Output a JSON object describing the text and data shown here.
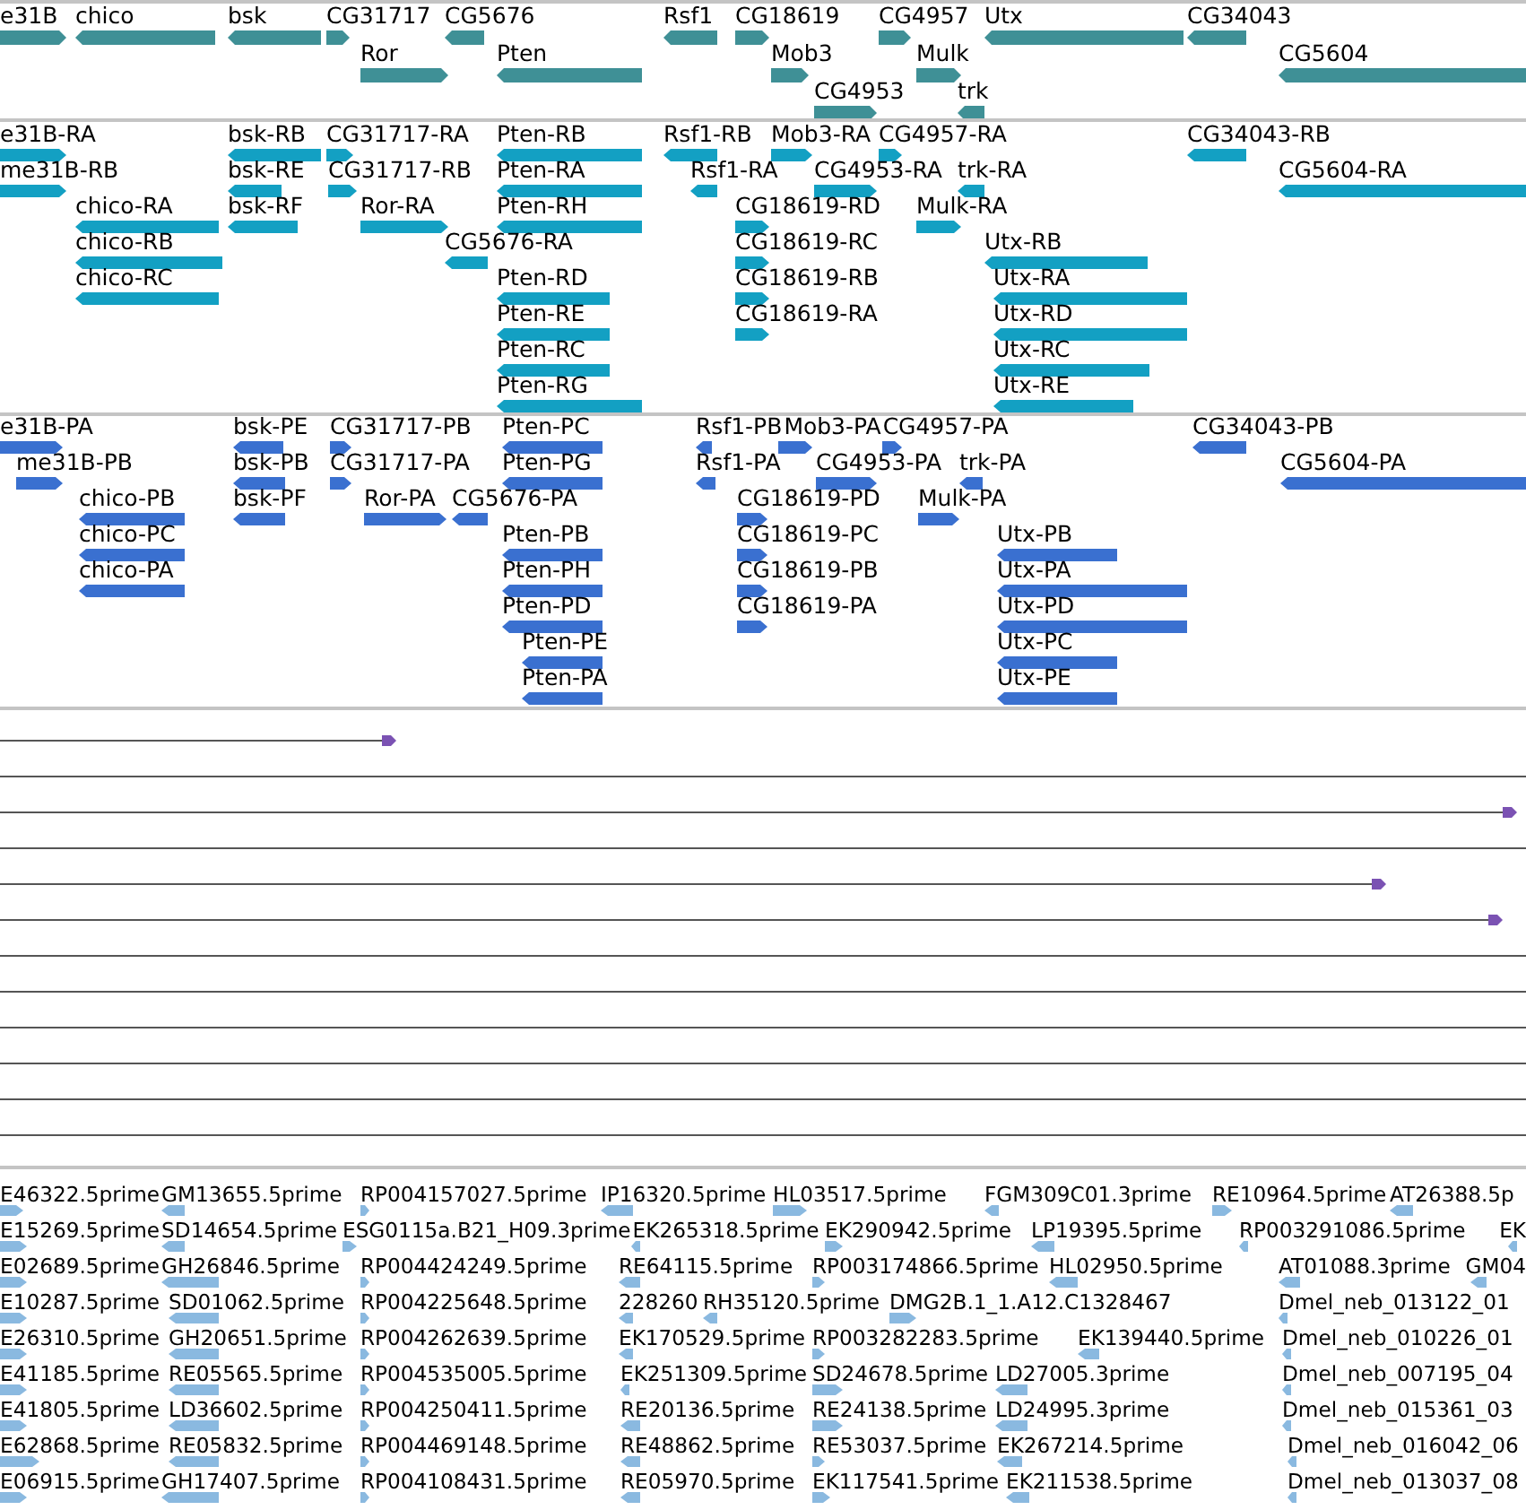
{
  "tracks": [
    {
      "kind": "genes",
      "features": [
        {
          "label": "e31B",
          "reverse": false
        },
        {
          "label": "chico",
          "reverse": true
        },
        {
          "label": "bsk",
          "reverse": true
        },
        {
          "label": "CG31717",
          "reverse": false
        },
        {
          "label": "CG5676",
          "reverse": true
        },
        {
          "label": "Rsf1",
          "reverse": true
        },
        {
          "label": "CG18619",
          "reverse": false
        },
        {
          "label": "CG4957",
          "reverse": false
        },
        {
          "label": "Utx",
          "reverse": true
        },
        {
          "label": "CG34043",
          "reverse": true
        },
        {
          "label": "Ror",
          "reverse": false
        },
        {
          "label": "Pten",
          "reverse": true
        },
        {
          "label": "Mob3",
          "reverse": false
        },
        {
          "label": "Mulk",
          "reverse": false
        },
        {
          "label": "CG5604",
          "reverse": true
        },
        {
          "label": "CG4953",
          "reverse": false
        },
        {
          "label": "trk",
          "reverse": true
        }
      ]
    },
    {
      "kind": "transcripts",
      "features": [
        {
          "label": "e31B-RA",
          "reverse": false
        },
        {
          "label": "bsk-RB",
          "reverse": true
        },
        {
          "label": "CG31717-RA",
          "reverse": false
        },
        {
          "label": "Pten-RB",
          "reverse": true
        },
        {
          "label": "Rsf1-RB",
          "reverse": true
        },
        {
          "label": "Mob3-RA",
          "reverse": false
        },
        {
          "label": "CG4957-RA",
          "reverse": false
        },
        {
          "label": "CG34043-RB",
          "reverse": true
        },
        {
          "label": "me31B-RB",
          "reverse": false
        },
        {
          "label": "bsk-RE",
          "reverse": true
        },
        {
          "label": "CG31717-RB",
          "reverse": false
        },
        {
          "label": "Pten-RA",
          "reverse": true
        },
        {
          "label": "Rsf1-RA",
          "reverse": true
        },
        {
          "label": "CG4953-RA",
          "reverse": false
        },
        {
          "label": "trk-RA",
          "reverse": true
        },
        {
          "label": "CG5604-RA",
          "reverse": true
        },
        {
          "label": "chico-RA",
          "reverse": true
        },
        {
          "label": "bsk-RF",
          "reverse": true
        },
        {
          "label": "Ror-RA",
          "reverse": false
        },
        {
          "label": "Pten-RH",
          "reverse": true
        },
        {
          "label": "CG18619-RD",
          "reverse": false
        },
        {
          "label": "Mulk-RA",
          "reverse": false
        },
        {
          "label": "chico-RB",
          "reverse": true
        },
        {
          "label": "CG5676-RA",
          "reverse": true
        },
        {
          "label": "CG18619-RC",
          "reverse": false
        },
        {
          "label": "Utx-RB",
          "reverse": true
        },
        {
          "label": "chico-RC",
          "reverse": true
        },
        {
          "label": "Pten-RD",
          "reverse": true
        },
        {
          "label": "CG18619-RB",
          "reverse": false
        },
        {
          "label": "Utx-RA",
          "reverse": true
        },
        {
          "label": "Pten-RE",
          "reverse": true
        },
        {
          "label": "CG18619-RA",
          "reverse": false
        },
        {
          "label": "Utx-RD",
          "reverse": true
        },
        {
          "label": "Pten-RC",
          "reverse": true
        },
        {
          "label": "Utx-RC",
          "reverse": true
        },
        {
          "label": "Pten-RG",
          "reverse": true
        },
        {
          "label": "Utx-RE",
          "reverse": true
        }
      ]
    },
    {
      "kind": "proteins",
      "features": [
        {
          "label": "e31B-PA",
          "reverse": false
        },
        {
          "label": "bsk-PE",
          "reverse": true
        },
        {
          "label": "CG31717-PB",
          "reverse": false
        },
        {
          "label": "Pten-PC",
          "reverse": true
        },
        {
          "label": "Rsf1-PB",
          "reverse": true
        },
        {
          "label": "Mob3-PA",
          "reverse": false
        },
        {
          "label": "CG4957-PA",
          "reverse": false
        },
        {
          "label": "CG34043-PB",
          "reverse": true
        },
        {
          "label": "me31B-PB",
          "reverse": false
        },
        {
          "label": "bsk-PB",
          "reverse": true
        },
        {
          "label": "CG31717-PA",
          "reverse": false
        },
        {
          "label": "Pten-PG",
          "reverse": true
        },
        {
          "label": "Rsf1-PA",
          "reverse": true
        },
        {
          "label": "CG4953-PA",
          "reverse": false
        },
        {
          "label": "trk-PA",
          "reverse": true
        },
        {
          "label": "CG5604-PA",
          "reverse": true
        },
        {
          "label": "chico-PB",
          "reverse": true
        },
        {
          "label": "bsk-PF",
          "reverse": true
        },
        {
          "label": "Ror-PA",
          "reverse": false
        },
        {
          "label": "CG5676-PA",
          "reverse": true
        },
        {
          "label": "CG18619-PD",
          "reverse": false
        },
        {
          "label": "Mulk-PA",
          "reverse": false
        },
        {
          "label": "chico-PC",
          "reverse": true
        },
        {
          "label": "Pten-PB",
          "reverse": true
        },
        {
          "label": "CG18619-PC",
          "reverse": false
        },
        {
          "label": "Utx-PB",
          "reverse": true
        },
        {
          "label": "chico-PA",
          "reverse": true
        },
        {
          "label": "Pten-PH",
          "reverse": true
        },
        {
          "label": "CG18619-PB",
          "reverse": false
        },
        {
          "label": "Utx-PA",
          "reverse": true
        },
        {
          "label": "Pten-PD",
          "reverse": true
        },
        {
          "label": "CG18619-PA",
          "reverse": false
        },
        {
          "label": "Utx-PD",
          "reverse": true
        },
        {
          "label": "Pten-PE",
          "reverse": true
        },
        {
          "label": "Utx-PC",
          "reverse": true
        },
        {
          "label": "Pten-PA",
          "reverse": true
        },
        {
          "label": "Utx-PE",
          "reverse": true
        }
      ]
    },
    {
      "kind": "alignments"
    },
    {
      "kind": "ests",
      "features": [
        {
          "label": "E46322.5prime",
          "reverse": false
        },
        {
          "label": "GM13655.5prime",
          "reverse": true
        },
        {
          "label": "RP004157027.5prime",
          "reverse": false
        },
        {
          "label": "IP16320.5prime",
          "reverse": true
        },
        {
          "label": "HL03517.5prime",
          "reverse": false
        },
        {
          "label": "FGM309C01.3prime",
          "reverse": true
        },
        {
          "label": "RE10964.5prime",
          "reverse": false
        },
        {
          "label": "AT26388.5p",
          "reverse": true
        },
        {
          "label": "E15269.5prime",
          "reverse": false
        },
        {
          "label": "SD14654.5prime",
          "reverse": true
        },
        {
          "label": "ESG0115a.B21_H09.3prime",
          "reverse": false
        },
        {
          "label": "EK265318.5prime",
          "reverse": true
        },
        {
          "label": "EK290942.5prime",
          "reverse": false
        },
        {
          "label": "LP19395.5prime",
          "reverse": true
        },
        {
          "label": "RP003291086.5prime",
          "reverse": true
        },
        {
          "label": "EK",
          "reverse": true
        },
        {
          "label": "E02689.5prime",
          "reverse": false
        },
        {
          "label": "GH26846.5prime",
          "reverse": true
        },
        {
          "label": "RP004424249.5prime",
          "reverse": false
        },
        {
          "label": "RE64115.5prime",
          "reverse": true
        },
        {
          "label": "RP003174866.5prime",
          "reverse": false
        },
        {
          "label": "HL02950.5prime",
          "reverse": true
        },
        {
          "label": "AT01088.3prime",
          "reverse": true
        },
        {
          "label": "GM04",
          "reverse": true
        },
        {
          "label": "E10287.5prime",
          "reverse": false
        },
        {
          "label": "SD01062.5prime",
          "reverse": true
        },
        {
          "label": "RP004225648.5prime",
          "reverse": false
        },
        {
          "label": "228260",
          "reverse": true
        },
        {
          "label": "RH35120.5prime",
          "reverse": true
        },
        {
          "label": "DMG2B.1_1.A12.C1328467",
          "reverse": false
        },
        {
          "label": "Dmel_neb_013122_01",
          "reverse": true
        },
        {
          "label": "E26310.5prime",
          "reverse": false
        },
        {
          "label": "GH20651.5prime",
          "reverse": true
        },
        {
          "label": "RP004262639.5prime",
          "reverse": false
        },
        {
          "label": "EK170529.5prime",
          "reverse": true
        },
        {
          "label": "RP003282283.5prime",
          "reverse": false
        },
        {
          "label": "EK139440.5prime",
          "reverse": true
        },
        {
          "label": "Dmel_neb_010226_01",
          "reverse": true
        },
        {
          "label": "E41185.5prime",
          "reverse": false
        },
        {
          "label": "RE05565.5prime",
          "reverse": true
        },
        {
          "label": "RP004535005.5prime",
          "reverse": false
        },
        {
          "label": "EK251309.5prime",
          "reverse": true
        },
        {
          "label": "SD24678.5prime",
          "reverse": false
        },
        {
          "label": "LD27005.3prime",
          "reverse": true
        },
        {
          "label": "Dmel_neb_007195_04",
          "reverse": true
        },
        {
          "label": "E41805.5prime",
          "reverse": false
        },
        {
          "label": "LD36602.5prime",
          "reverse": true
        },
        {
          "label": "RP004250411.5prime",
          "reverse": false
        },
        {
          "label": "RE20136.5prime",
          "reverse": true
        },
        {
          "label": "RE24138.5prime",
          "reverse": false
        },
        {
          "label": "LD24995.3prime",
          "reverse": true
        },
        {
          "label": "Dmel_neb_015361_03",
          "reverse": true
        },
        {
          "label": "E62868.5prime",
          "reverse": false
        },
        {
          "label": "RE05832.5prime",
          "reverse": true
        },
        {
          "label": "RP004469148.5prime",
          "reverse": false
        },
        {
          "label": "RE48862.5prime",
          "reverse": true
        },
        {
          "label": "RE53037.5prime",
          "reverse": false
        },
        {
          "label": "EK267214.5prime",
          "reverse": true
        },
        {
          "label": "Dmel_neb_016042_06",
          "reverse": true
        },
        {
          "label": "E06915.5prime",
          "reverse": false
        },
        {
          "label": "GH17407.5prime",
          "reverse": true
        },
        {
          "label": "RP004108431.5prime",
          "reverse": false
        },
        {
          "label": "RE05970.5prime",
          "reverse": true
        },
        {
          "label": "EK117541.5prime",
          "reverse": false
        },
        {
          "label": "EK211538.5prime",
          "reverse": true
        },
        {
          "label": "Dmel_neb_013037_08",
          "reverse": true
        }
      ]
    }
  ]
}
